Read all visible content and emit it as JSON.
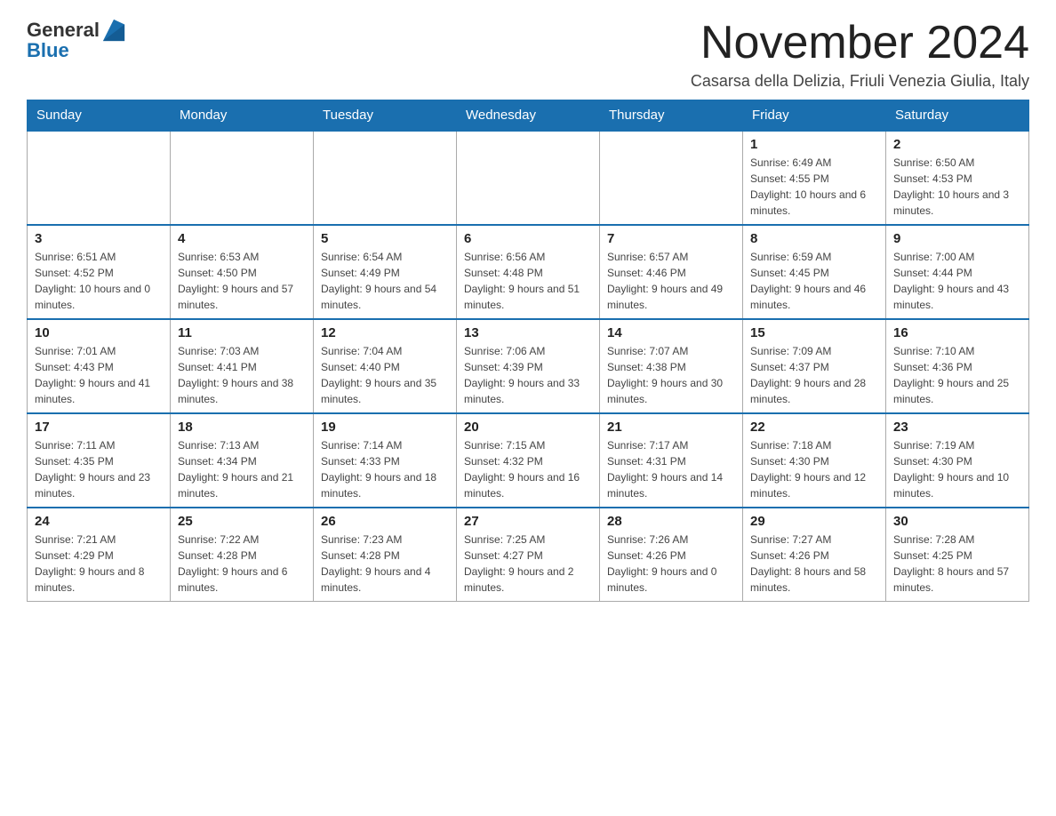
{
  "header": {
    "logo_general": "General",
    "logo_blue": "Blue",
    "month_title": "November 2024",
    "location": "Casarsa della Delizia, Friuli Venezia Giulia, Italy"
  },
  "days_of_week": [
    "Sunday",
    "Monday",
    "Tuesday",
    "Wednesday",
    "Thursday",
    "Friday",
    "Saturday"
  ],
  "weeks": [
    [
      {
        "day": "",
        "info": ""
      },
      {
        "day": "",
        "info": ""
      },
      {
        "day": "",
        "info": ""
      },
      {
        "day": "",
        "info": ""
      },
      {
        "day": "",
        "info": ""
      },
      {
        "day": "1",
        "info": "Sunrise: 6:49 AM\nSunset: 4:55 PM\nDaylight: 10 hours and 6 minutes."
      },
      {
        "day": "2",
        "info": "Sunrise: 6:50 AM\nSunset: 4:53 PM\nDaylight: 10 hours and 3 minutes."
      }
    ],
    [
      {
        "day": "3",
        "info": "Sunrise: 6:51 AM\nSunset: 4:52 PM\nDaylight: 10 hours and 0 minutes."
      },
      {
        "day": "4",
        "info": "Sunrise: 6:53 AM\nSunset: 4:50 PM\nDaylight: 9 hours and 57 minutes."
      },
      {
        "day": "5",
        "info": "Sunrise: 6:54 AM\nSunset: 4:49 PM\nDaylight: 9 hours and 54 minutes."
      },
      {
        "day": "6",
        "info": "Sunrise: 6:56 AM\nSunset: 4:48 PM\nDaylight: 9 hours and 51 minutes."
      },
      {
        "day": "7",
        "info": "Sunrise: 6:57 AM\nSunset: 4:46 PM\nDaylight: 9 hours and 49 minutes."
      },
      {
        "day": "8",
        "info": "Sunrise: 6:59 AM\nSunset: 4:45 PM\nDaylight: 9 hours and 46 minutes."
      },
      {
        "day": "9",
        "info": "Sunrise: 7:00 AM\nSunset: 4:44 PM\nDaylight: 9 hours and 43 minutes."
      }
    ],
    [
      {
        "day": "10",
        "info": "Sunrise: 7:01 AM\nSunset: 4:43 PM\nDaylight: 9 hours and 41 minutes."
      },
      {
        "day": "11",
        "info": "Sunrise: 7:03 AM\nSunset: 4:41 PM\nDaylight: 9 hours and 38 minutes."
      },
      {
        "day": "12",
        "info": "Sunrise: 7:04 AM\nSunset: 4:40 PM\nDaylight: 9 hours and 35 minutes."
      },
      {
        "day": "13",
        "info": "Sunrise: 7:06 AM\nSunset: 4:39 PM\nDaylight: 9 hours and 33 minutes."
      },
      {
        "day": "14",
        "info": "Sunrise: 7:07 AM\nSunset: 4:38 PM\nDaylight: 9 hours and 30 minutes."
      },
      {
        "day": "15",
        "info": "Sunrise: 7:09 AM\nSunset: 4:37 PM\nDaylight: 9 hours and 28 minutes."
      },
      {
        "day": "16",
        "info": "Sunrise: 7:10 AM\nSunset: 4:36 PM\nDaylight: 9 hours and 25 minutes."
      }
    ],
    [
      {
        "day": "17",
        "info": "Sunrise: 7:11 AM\nSunset: 4:35 PM\nDaylight: 9 hours and 23 minutes."
      },
      {
        "day": "18",
        "info": "Sunrise: 7:13 AM\nSunset: 4:34 PM\nDaylight: 9 hours and 21 minutes."
      },
      {
        "day": "19",
        "info": "Sunrise: 7:14 AM\nSunset: 4:33 PM\nDaylight: 9 hours and 18 minutes."
      },
      {
        "day": "20",
        "info": "Sunrise: 7:15 AM\nSunset: 4:32 PM\nDaylight: 9 hours and 16 minutes."
      },
      {
        "day": "21",
        "info": "Sunrise: 7:17 AM\nSunset: 4:31 PM\nDaylight: 9 hours and 14 minutes."
      },
      {
        "day": "22",
        "info": "Sunrise: 7:18 AM\nSunset: 4:30 PM\nDaylight: 9 hours and 12 minutes."
      },
      {
        "day": "23",
        "info": "Sunrise: 7:19 AM\nSunset: 4:30 PM\nDaylight: 9 hours and 10 minutes."
      }
    ],
    [
      {
        "day": "24",
        "info": "Sunrise: 7:21 AM\nSunset: 4:29 PM\nDaylight: 9 hours and 8 minutes."
      },
      {
        "day": "25",
        "info": "Sunrise: 7:22 AM\nSunset: 4:28 PM\nDaylight: 9 hours and 6 minutes."
      },
      {
        "day": "26",
        "info": "Sunrise: 7:23 AM\nSunset: 4:28 PM\nDaylight: 9 hours and 4 minutes."
      },
      {
        "day": "27",
        "info": "Sunrise: 7:25 AM\nSunset: 4:27 PM\nDaylight: 9 hours and 2 minutes."
      },
      {
        "day": "28",
        "info": "Sunrise: 7:26 AM\nSunset: 4:26 PM\nDaylight: 9 hours and 0 minutes."
      },
      {
        "day": "29",
        "info": "Sunrise: 7:27 AM\nSunset: 4:26 PM\nDaylight: 8 hours and 58 minutes."
      },
      {
        "day": "30",
        "info": "Sunrise: 7:28 AM\nSunset: 4:25 PM\nDaylight: 8 hours and 57 minutes."
      }
    ]
  ]
}
